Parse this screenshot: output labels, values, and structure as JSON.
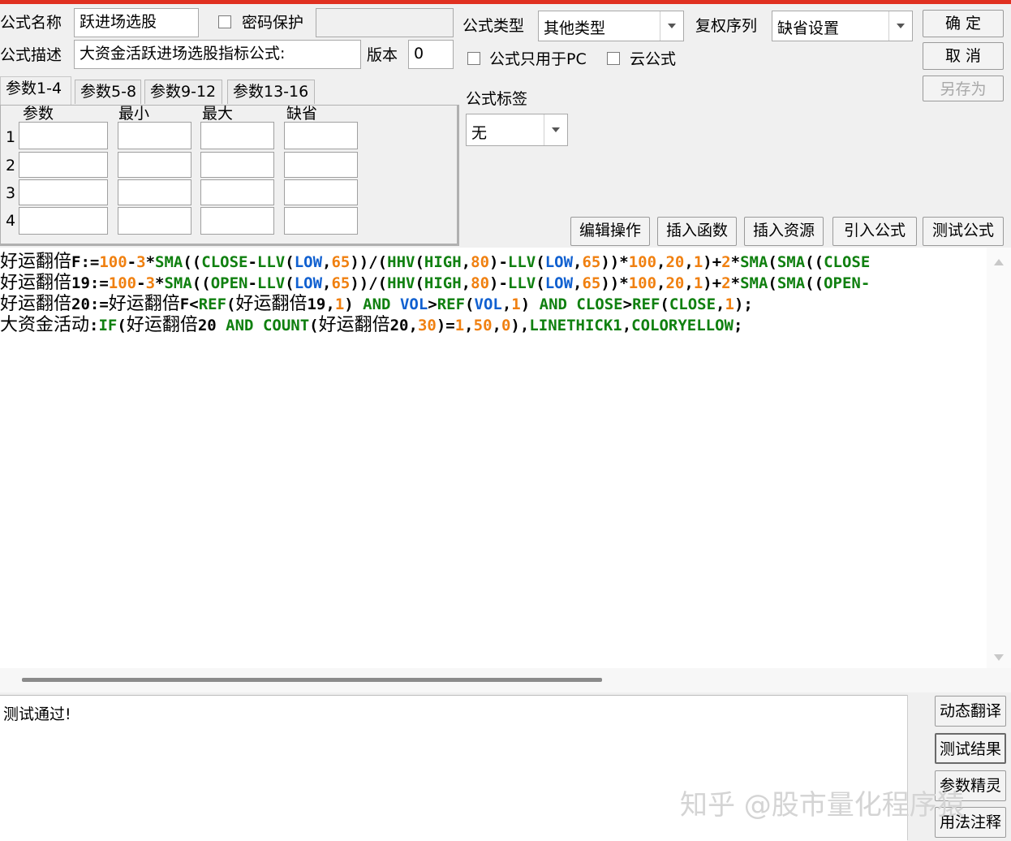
{
  "form": {
    "name_label": "公式名称",
    "name_value": "跃进场选股",
    "password_label": "密码保护",
    "desc_label": "公式描述",
    "desc_value": "大资金活跃进场选股指标公式:",
    "version_label": "版本",
    "version_value": "0",
    "type_label": "公式类型",
    "type_value": "其他类型",
    "rights_label": "复权序列",
    "rights_value": "缺省设置",
    "pc_only_label": "公式只用于PC",
    "cloud_label": "云公式",
    "tag_label": "公式标签",
    "tag_value": "无"
  },
  "buttons": {
    "ok": "确  定",
    "cancel": "取  消",
    "save_as": "另存为",
    "edit_ops": "编辑操作",
    "insert_func": "插入函数",
    "insert_res": "插入资源",
    "import_formula": "引入公式",
    "test_formula": "测试公式",
    "dyn_translate": "动态翻译",
    "test_result": "测试结果",
    "param_wizard": "参数精灵",
    "usage_notes": "用法注释"
  },
  "tabs": [
    "参数1-4",
    "参数5-8",
    "参数9-12",
    "参数13-16"
  ],
  "params": {
    "headers": [
      "参数",
      "最小",
      "最大",
      "缺省"
    ],
    "rows": [
      "1",
      "2",
      "3",
      "4"
    ]
  },
  "code": {
    "line1": [
      {
        "t": "好运翻倍",
        "c": "cn"
      },
      {
        "t": "F:=",
        "c": "b"
      },
      {
        "t": "100",
        "c": "o"
      },
      {
        "t": "-",
        "c": "b"
      },
      {
        "t": "3",
        "c": "o"
      },
      {
        "t": "*",
        "c": "b"
      },
      {
        "t": "SMA",
        "c": "g"
      },
      {
        "t": "((",
        "c": "b"
      },
      {
        "t": "CLOSE",
        "c": "g"
      },
      {
        "t": "-",
        "c": "b"
      },
      {
        "t": "LLV",
        "c": "g"
      },
      {
        "t": "(",
        "c": "b"
      },
      {
        "t": "LOW",
        "c": "bl"
      },
      {
        "t": ",",
        "c": "b"
      },
      {
        "t": "65",
        "c": "o"
      },
      {
        "t": "))/(",
        "c": "b"
      },
      {
        "t": "HHV",
        "c": "g"
      },
      {
        "t": "(",
        "c": "b"
      },
      {
        "t": "HIGH",
        "c": "g"
      },
      {
        "t": ",",
        "c": "b"
      },
      {
        "t": "80",
        "c": "o"
      },
      {
        "t": ")-",
        "c": "b"
      },
      {
        "t": "LLV",
        "c": "g"
      },
      {
        "t": "(",
        "c": "b"
      },
      {
        "t": "LOW",
        "c": "bl"
      },
      {
        "t": ",",
        "c": "b"
      },
      {
        "t": "65",
        "c": "o"
      },
      {
        "t": "))*",
        "c": "b"
      },
      {
        "t": "100",
        "c": "o"
      },
      {
        "t": ",",
        "c": "b"
      },
      {
        "t": "20",
        "c": "o"
      },
      {
        "t": ",",
        "c": "b"
      },
      {
        "t": "1",
        "c": "o"
      },
      {
        "t": ")+",
        "c": "b"
      },
      {
        "t": "2",
        "c": "o"
      },
      {
        "t": "*",
        "c": "b"
      },
      {
        "t": "SMA",
        "c": "g"
      },
      {
        "t": "(",
        "c": "b"
      },
      {
        "t": "SMA",
        "c": "g"
      },
      {
        "t": "((",
        "c": "b"
      },
      {
        "t": "CLOSE",
        "c": "g"
      }
    ],
    "line2": [
      {
        "t": "好运翻倍",
        "c": "cn"
      },
      {
        "t": "19:=",
        "c": "b"
      },
      {
        "t": "100",
        "c": "o"
      },
      {
        "t": "-",
        "c": "b"
      },
      {
        "t": "3",
        "c": "o"
      },
      {
        "t": "*",
        "c": "b"
      },
      {
        "t": "SMA",
        "c": "g"
      },
      {
        "t": "((",
        "c": "b"
      },
      {
        "t": "OPEN",
        "c": "g"
      },
      {
        "t": "-",
        "c": "b"
      },
      {
        "t": "LLV",
        "c": "g"
      },
      {
        "t": "(",
        "c": "b"
      },
      {
        "t": "LOW",
        "c": "bl"
      },
      {
        "t": ",",
        "c": "b"
      },
      {
        "t": "65",
        "c": "o"
      },
      {
        "t": "))/(",
        "c": "b"
      },
      {
        "t": "HHV",
        "c": "g"
      },
      {
        "t": "(",
        "c": "b"
      },
      {
        "t": "HIGH",
        "c": "g"
      },
      {
        "t": ",",
        "c": "b"
      },
      {
        "t": "80",
        "c": "o"
      },
      {
        "t": ")-",
        "c": "b"
      },
      {
        "t": "LLV",
        "c": "g"
      },
      {
        "t": "(",
        "c": "b"
      },
      {
        "t": "LOW",
        "c": "bl"
      },
      {
        "t": ",",
        "c": "b"
      },
      {
        "t": "65",
        "c": "o"
      },
      {
        "t": "))*",
        "c": "b"
      },
      {
        "t": "100",
        "c": "o"
      },
      {
        "t": ",",
        "c": "b"
      },
      {
        "t": "20",
        "c": "o"
      },
      {
        "t": ",",
        "c": "b"
      },
      {
        "t": "1",
        "c": "o"
      },
      {
        "t": ")+",
        "c": "b"
      },
      {
        "t": "2",
        "c": "o"
      },
      {
        "t": "*",
        "c": "b"
      },
      {
        "t": "SMA",
        "c": "g"
      },
      {
        "t": "(",
        "c": "b"
      },
      {
        "t": "SMA",
        "c": "g"
      },
      {
        "t": "((",
        "c": "b"
      },
      {
        "t": "OPEN-",
        "c": "g"
      }
    ],
    "line3": [
      {
        "t": "好运翻倍",
        "c": "cn"
      },
      {
        "t": "20:=",
        "c": "b"
      },
      {
        "t": "好运翻倍",
        "c": "cn"
      },
      {
        "t": "F<",
        "c": "b"
      },
      {
        "t": "REF",
        "c": "g"
      },
      {
        "t": "(",
        "c": "b"
      },
      {
        "t": "好运翻倍",
        "c": "cn"
      },
      {
        "t": "19,",
        "c": "b"
      },
      {
        "t": "1",
        "c": "o"
      },
      {
        "t": ") ",
        "c": "b"
      },
      {
        "t": "AND",
        "c": "g"
      },
      {
        "t": " ",
        "c": "b"
      },
      {
        "t": "VOL",
        "c": "bl"
      },
      {
        "t": ">",
        "c": "b"
      },
      {
        "t": "REF",
        "c": "g"
      },
      {
        "t": "(",
        "c": "b"
      },
      {
        "t": "VOL",
        "c": "bl"
      },
      {
        "t": ",",
        "c": "b"
      },
      {
        "t": "1",
        "c": "o"
      },
      {
        "t": ") ",
        "c": "b"
      },
      {
        "t": "AND",
        "c": "g"
      },
      {
        "t": " ",
        "c": "b"
      },
      {
        "t": "CLOSE",
        "c": "g"
      },
      {
        "t": ">",
        "c": "b"
      },
      {
        "t": "REF",
        "c": "g"
      },
      {
        "t": "(",
        "c": "b"
      },
      {
        "t": "CLOSE",
        "c": "g"
      },
      {
        "t": ",",
        "c": "b"
      },
      {
        "t": "1",
        "c": "o"
      },
      {
        "t": ");",
        "c": "b"
      }
    ],
    "line4": [
      {
        "t": "大资金活动",
        "c": "cn"
      },
      {
        "t": ":",
        "c": "b"
      },
      {
        "t": "IF",
        "c": "g"
      },
      {
        "t": "(",
        "c": "b"
      },
      {
        "t": "好运翻倍",
        "c": "cn"
      },
      {
        "t": "20 ",
        "c": "b"
      },
      {
        "t": "AND",
        "c": "g"
      },
      {
        "t": " ",
        "c": "b"
      },
      {
        "t": "COUNT",
        "c": "g"
      },
      {
        "t": "(",
        "c": "b"
      },
      {
        "t": "好运翻倍",
        "c": "cn"
      },
      {
        "t": "20,",
        "c": "b"
      },
      {
        "t": "30",
        "c": "o"
      },
      {
        "t": ")=",
        "c": "b"
      },
      {
        "t": "1",
        "c": "o"
      },
      {
        "t": ",",
        "c": "b"
      },
      {
        "t": "50",
        "c": "o"
      },
      {
        "t": ",",
        "c": "b"
      },
      {
        "t": "0",
        "c": "o"
      },
      {
        "t": "),",
        "c": "b"
      },
      {
        "t": "LINETHICK1",
        "c": "g"
      },
      {
        "t": ",",
        "c": "b"
      },
      {
        "t": "COLORYELLOW",
        "c": "g"
      },
      {
        "t": ";",
        "c": "b"
      }
    ]
  },
  "output": {
    "text": "测试通过!"
  },
  "watermark": "知乎 @股市量化程序猿"
}
